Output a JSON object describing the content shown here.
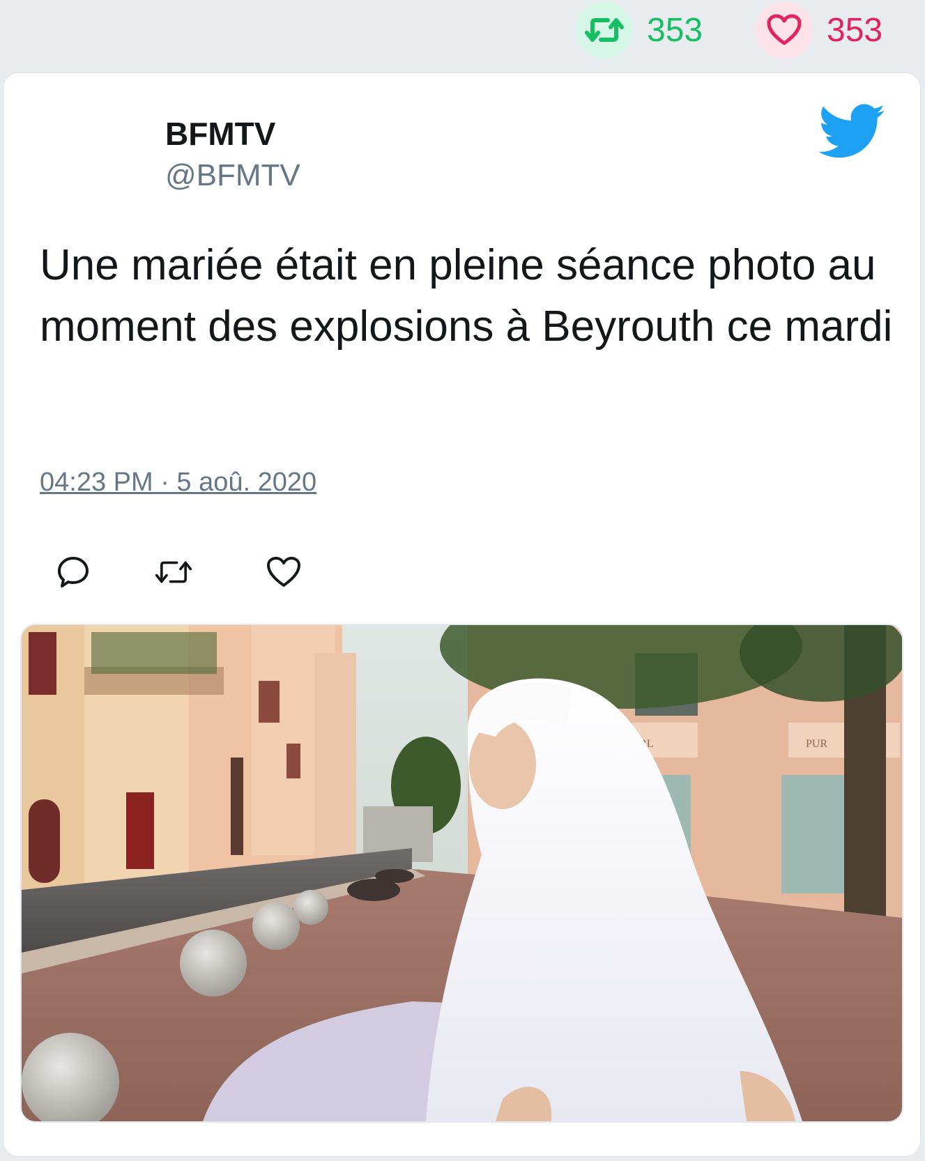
{
  "stats": {
    "retweet_count": "353",
    "like_count": "353",
    "retweet_color": "#17bf63",
    "like_color": "#e0245e"
  },
  "tweet": {
    "author_name": "BFMTV",
    "author_handle": "@BFMTV",
    "text": "Une mariée était en pleine séance photo au moment des explosions à Beyrouth ce mardi",
    "timestamp": "04:23 PM · 5 aoû. 2020"
  },
  "icons": {
    "retweet": "retweet-icon",
    "like": "heart-icon",
    "reply": "reply-icon",
    "brand": "twitter-bird-icon"
  },
  "media": {
    "storefront_sign_1": "PURRL",
    "storefront_sign_2": "PUR"
  },
  "colors": {
    "brand_blue": "#1da1f2",
    "text_primary": "#14171a",
    "text_secondary": "#657786"
  }
}
